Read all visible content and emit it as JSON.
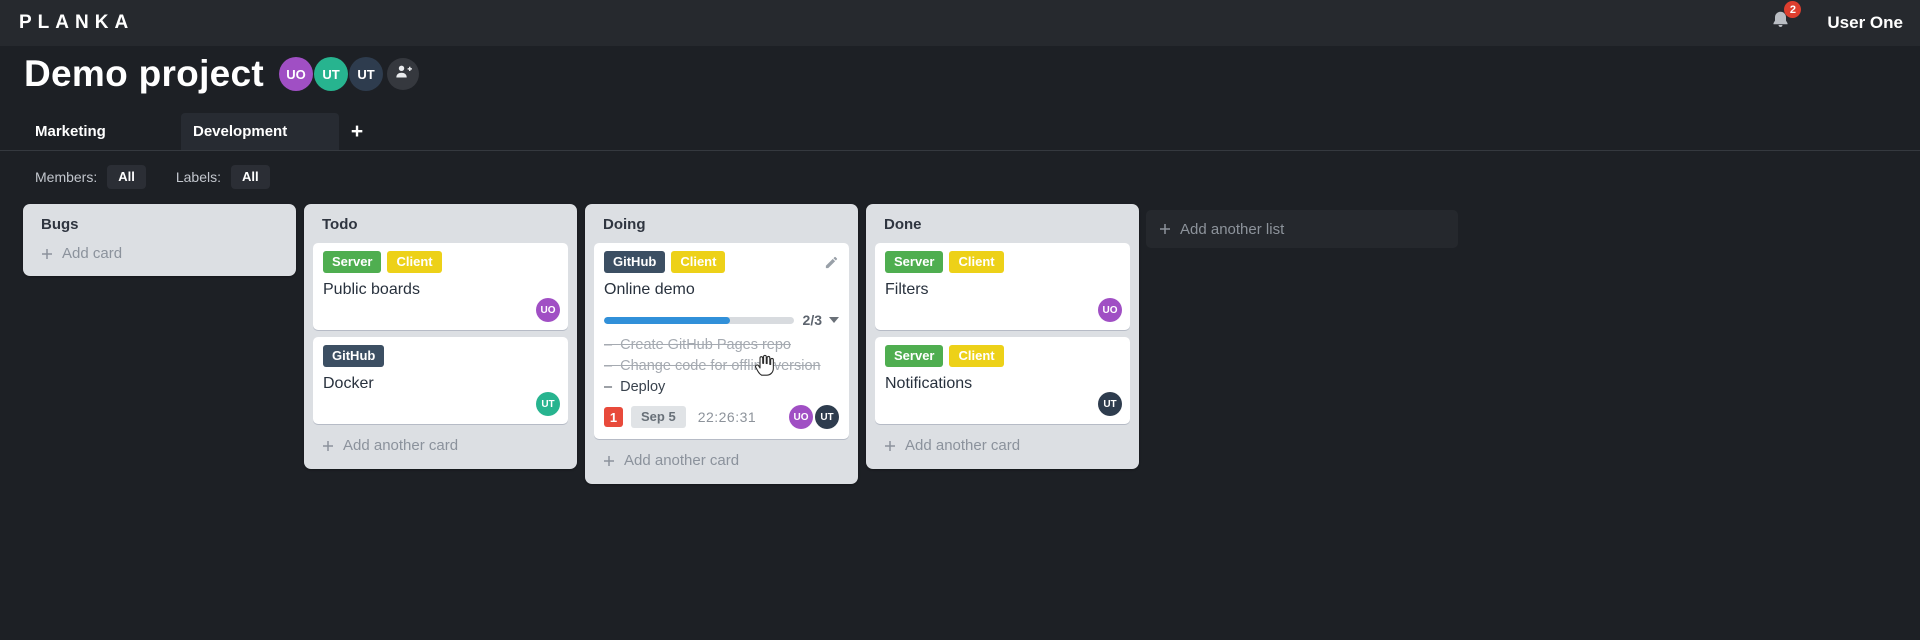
{
  "colors": {
    "topbar_bg": "#26292e",
    "page_bg": "#1d2025",
    "list_bg": "#dcdfe3",
    "card_bg": "#ffffff",
    "progress_blue": "#3190d9",
    "label_green": "#4fae50",
    "label_yellow": "#edd118",
    "label_dark": "#3c4f63",
    "avatar_purple": "#a04fc4",
    "avatar_teal": "#27b48f",
    "avatar_navy": "#2e3c4e",
    "badge_red": "#e84a3b"
  },
  "topbar": {
    "logo": "PLANKA",
    "notifications_count": "2",
    "user_name": "User One"
  },
  "project": {
    "title": "Demo project",
    "members": [
      {
        "initials": "UO",
        "color": "#a04fc4"
      },
      {
        "initials": "UT",
        "color": "#27b48f"
      },
      {
        "initials": "UT",
        "color": "#2e3c4e"
      }
    ]
  },
  "tabs": {
    "items": [
      {
        "label": "Marketing",
        "active": false
      },
      {
        "label": "Development",
        "active": true
      }
    ],
    "add_button": "+"
  },
  "filters": {
    "members_label": "Members:",
    "members_value": "All",
    "labels_label": "Labels:",
    "labels_value": "All"
  },
  "board": {
    "add_list_label": "Add another list",
    "lists": [
      {
        "name": "Bugs",
        "add_card_label": "Add card",
        "cards": []
      },
      {
        "name": "Todo",
        "add_card_label": "Add another card",
        "cards": [
          {
            "title": "Public boards",
            "labels": [
              {
                "text": "Server",
                "color": "#4fae50"
              },
              {
                "text": "Client",
                "color": "#edd118"
              }
            ],
            "members": [
              {
                "initials": "UO",
                "color": "#a04fc4"
              }
            ]
          },
          {
            "title": "Docker",
            "labels": [
              {
                "text": "GitHub",
                "color": "#3c4f63"
              }
            ],
            "members": [
              {
                "initials": "UT",
                "color": "#27b48f"
              }
            ]
          }
        ]
      },
      {
        "name": "Doing",
        "add_card_label": "Add another card",
        "cards": [
          {
            "title": "Online demo",
            "labels": [
              {
                "text": "GitHub",
                "color": "#3c4f63"
              },
              {
                "text": "Client",
                "color": "#edd118"
              }
            ],
            "progress": {
              "completed": 2,
              "total": 3,
              "text": "2/3",
              "percent": 66.7
            },
            "tasks": [
              {
                "text": "Create GitHub Pages repo",
                "done": true
              },
              {
                "text": "Change code for offline version",
                "done": true
              },
              {
                "text": "Deploy",
                "done": false
              }
            ],
            "notification_count": "1",
            "due_date": "Sep 5",
            "timer": "22:26:31",
            "members": [
              {
                "initials": "UO",
                "color": "#a04fc4"
              },
              {
                "initials": "UT",
                "color": "#2e3c4e"
              }
            ]
          }
        ]
      },
      {
        "name": "Done",
        "add_card_label": "Add another card",
        "cards": [
          {
            "title": "Filters",
            "labels": [
              {
                "text": "Server",
                "color": "#4fae50"
              },
              {
                "text": "Client",
                "color": "#edd118"
              }
            ],
            "members": [
              {
                "initials": "UO",
                "color": "#a04fc4"
              }
            ]
          },
          {
            "title": "Notifications",
            "labels": [
              {
                "text": "Server",
                "color": "#4fae50"
              },
              {
                "text": "Client",
                "color": "#edd118"
              }
            ],
            "members": [
              {
                "initials": "UT",
                "color": "#2e3c4e"
              }
            ]
          }
        ]
      }
    ]
  }
}
